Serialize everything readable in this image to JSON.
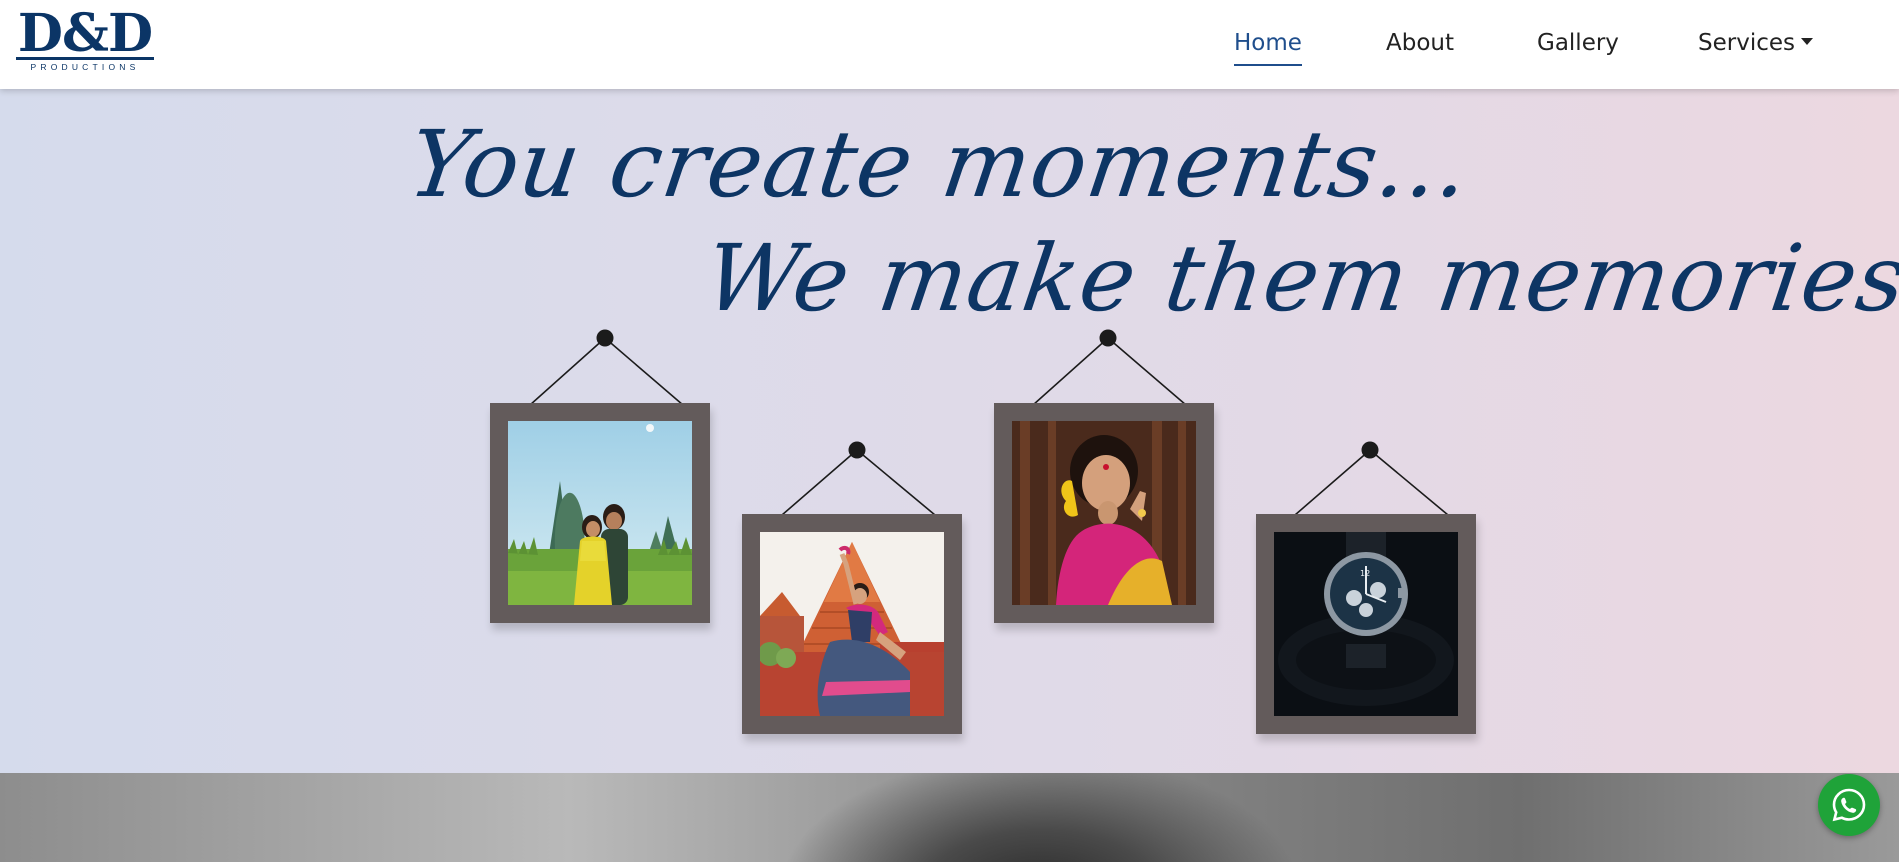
{
  "brand": {
    "logo_text": "D&D",
    "logo_subtext": "PRODUCTIONS",
    "color": "#0b3566"
  },
  "nav": {
    "items": [
      {
        "label": "Home",
        "active": true
      },
      {
        "label": "About",
        "active": false
      },
      {
        "label": "Gallery",
        "active": false
      },
      {
        "label": "Services",
        "active": false,
        "has_dropdown": true
      }
    ],
    "active_color": "#1f4e8c"
  },
  "hero": {
    "headline_line1": "You create moments...",
    "headline_line2": "We make them memories...",
    "text_color": "#0d3564",
    "frames": [
      {
        "subject": "couple-in-field-photo"
      },
      {
        "subject": "dancer-at-temple-photo"
      },
      {
        "subject": "bride-portrait-photo"
      },
      {
        "subject": "timex-watch-photo"
      }
    ],
    "frame_color": "#635b5b"
  },
  "floating": {
    "whatsapp_icon": "whatsapp-icon",
    "color": "#1fa339"
  }
}
